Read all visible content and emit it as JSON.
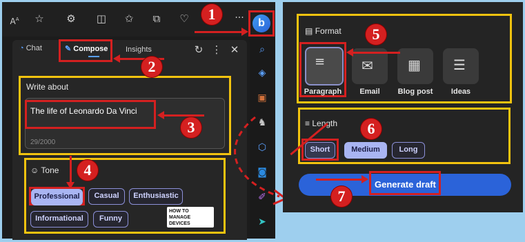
{
  "toolbar": {
    "icons": [
      "read-aloud-icon",
      "favorite-star-icon",
      "extensions-icon",
      "split-screen-icon",
      "favorites-list-icon",
      "collections-icon",
      "browser-essentials-icon",
      "more-icon",
      "copilot-icon"
    ],
    "more_label": "···"
  },
  "tabs": [
    {
      "label": "Chat",
      "active": false
    },
    {
      "label": "Compose",
      "active": true
    },
    {
      "label": "Insights",
      "active": false
    }
  ],
  "write_about": {
    "label": "Write about",
    "value": "The life of Leonardo Da Vinci",
    "counter": "29/2000"
  },
  "tone": {
    "label": "Tone",
    "options": [
      {
        "label": "Professional",
        "selected": true
      },
      {
        "label": "Casual",
        "selected": false
      },
      {
        "label": "Enthusiastic",
        "selected": false
      },
      {
        "label": "Informational",
        "selected": false
      },
      {
        "label": "Funny",
        "selected": false
      }
    ]
  },
  "logo": {
    "line1": "HOW TO",
    "line2": "MANAGE",
    "line3": "DEVICES"
  },
  "format": {
    "label": "Format",
    "options": [
      {
        "label": "Paragraph",
        "selected": true
      },
      {
        "label": "Email",
        "selected": false
      },
      {
        "label": "Blog post",
        "selected": false
      },
      {
        "label": "Ideas",
        "selected": false
      }
    ]
  },
  "length": {
    "label": "Length",
    "options": [
      {
        "label": "Short",
        "selected": true
      },
      {
        "label": "Medium",
        "selected": false
      },
      {
        "label": "Long",
        "selected": false
      }
    ]
  },
  "generate_button": "Generate draft",
  "callouts": [
    "1",
    "2",
    "3",
    "4",
    "5",
    "6",
    "7"
  ],
  "colors": {
    "accent_blue": "#2b63d9",
    "chip_selected": "#a9b5f2",
    "highlight_yellow": "#f2c30f",
    "annotation_red": "#d42020",
    "background": "#9ecfee"
  }
}
